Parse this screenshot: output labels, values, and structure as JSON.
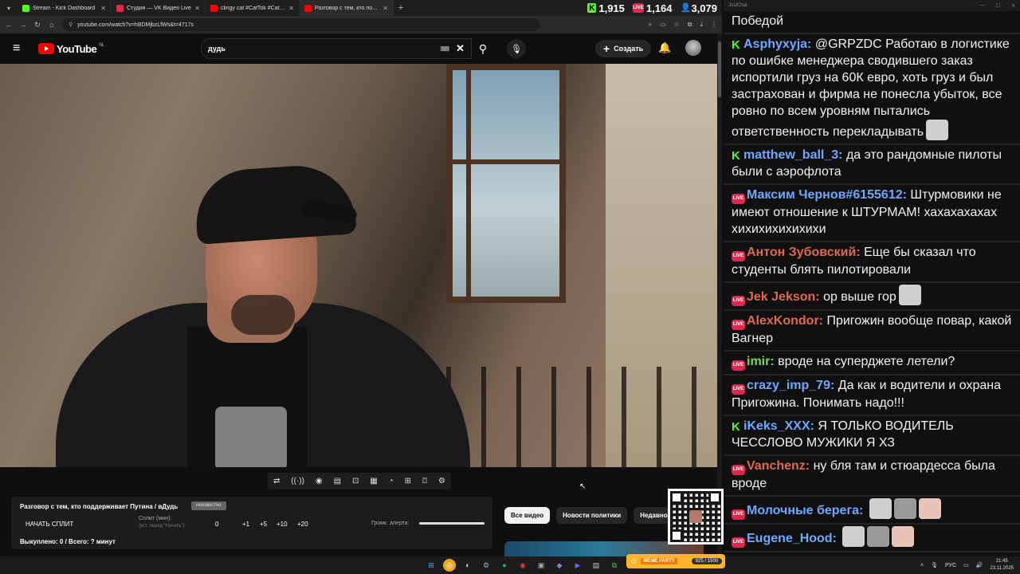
{
  "browser": {
    "tabs": [
      {
        "label": "Stream - Kick Dashboard",
        "color": "#53fc18"
      },
      {
        "label": "Студия — VK Видео Live",
        "color": "#e0284f"
      },
      {
        "label": "clingy cat #CatTok #CatFails202…",
        "color": "#ff0000"
      },
      {
        "label": "Разговор с тем, кто поддерж…",
        "color": "#ff0000"
      }
    ],
    "url": "youtube.com/watch?v=hBDMjbzLfWs&t=4717s"
  },
  "stream_stats": {
    "kick_viewers": "1,915",
    "vk_viewers": "1,164",
    "total_viewers": "3,079"
  },
  "youtube": {
    "logo": "YouTube",
    "region": "NL",
    "search_value": "дудь",
    "create_label": "Создать"
  },
  "split_panel": {
    "title": "Разговор с тем, кто поддерживает Путина / вДудь",
    "badge": "неизвестно",
    "start_label": "НАЧАТЬ СПЛИТ",
    "min_label": "Сплит (мин):",
    "min_hint": "(уст. перед \"Начать\")",
    "min_value": "0",
    "steps": [
      "+1",
      "+5",
      "+10",
      "+20"
    ],
    "volume_label": "Громк. алерта:",
    "volume_level": 1.0,
    "total": "Выкуплено: 0 / Всего: ? минут"
  },
  "chips": [
    "Все видео",
    "Новости политики",
    "Недавно о"
  ],
  "chat": {
    "window_title": "JustChat",
    "messages": [
      {
        "platform": "none",
        "user": "",
        "color": "#ffffff",
        "text": "Победой"
      },
      {
        "platform": "kick",
        "user": "Asphyxyja:",
        "color": "#6fa8ff",
        "text": "@GRPZDC Работаю в логистике по ошибке менеджера сводившего заказ испортили груз на 60К евро, хоть груз и был застрахован и фирма не понесла убыток, все ровно по всем уровням пытались ответственность перекладывать"
      },
      {
        "platform": "kick",
        "user": "matthew_ball_3:",
        "color": "#6fa8ff",
        "text": "да это рандомные пилоты были с аэрофлота"
      },
      {
        "platform": "vk",
        "user": "Максим Чернов#6155612:",
        "color": "#6fa8ff",
        "text": "Штурмовики не имеют отношение к ШТУРМАМ! хахахахахах хихихихихихихи"
      },
      {
        "platform": "vk",
        "user": "Антон Зубовский:",
        "color": "#e06a4d",
        "text": "Еще бы сказал что студенты блять пилотировали"
      },
      {
        "platform": "vk",
        "user": "Jek Jekson:",
        "color": "#e06a4d",
        "text": "ор выше гор"
      },
      {
        "platform": "vk",
        "user": "AlexKondor:",
        "color": "#e06a4d",
        "text": "Пригожин вообще повар, какой Вагнер"
      },
      {
        "platform": "vk",
        "user": "imir:",
        "color": "#7fd35a",
        "text": "вроде на суперджете летели?"
      },
      {
        "platform": "vk",
        "user": "crazy_imp_79:",
        "color": "#6fa8ff",
        "text": "Да как и водители и охрана Пригожина. Понимать надо!!!"
      },
      {
        "platform": "kick",
        "user": "iKeks_XXX:",
        "color": "#6fa8ff",
        "text": "Я ТОЛЬКО ВОДИТЕЛЬ ЧЕССЛОВО МУЖИКИ Я ХЗ"
      },
      {
        "platform": "vk",
        "user": "Vanchenz:",
        "color": "#e06a4d",
        "text": "ну бля там и стюардесса была вроде"
      },
      {
        "platform": "vk",
        "user": "Молочные берега:",
        "color": "#6fa8ff",
        "text": ""
      },
      {
        "platform": "vk",
        "user": "Eugene_Hood:",
        "color": "#6fa8ff",
        "text": ""
      }
    ]
  },
  "taskbar": {
    "meme_label": "MEME PARTY",
    "meme_value": "925 / 1500",
    "lang": "РУС",
    "time": "21:45",
    "date": "23.11.2025"
  }
}
